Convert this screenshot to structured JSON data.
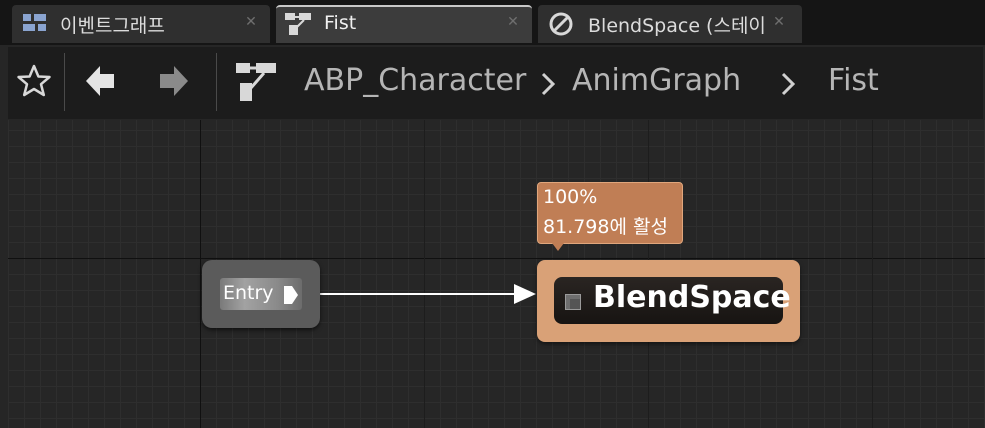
{
  "tabs": [
    {
      "label": "이벤트그래프",
      "icon": "event-graph-icon",
      "active": false
    },
    {
      "label": "Fist",
      "icon": "state-machine-icon",
      "active": true
    },
    {
      "label": "BlendSpace (스테이",
      "icon": "blendspace-icon",
      "active": false
    }
  ],
  "breadcrumb": {
    "items": [
      "ABP_Character",
      "AnimGraph",
      "Fist"
    ],
    "icon": "state-machine-icon"
  },
  "toolbar": {
    "favorite_icon": "star-icon",
    "back_icon": "back-arrow-icon",
    "forward_icon": "forward-arrow-icon"
  },
  "graph": {
    "entry_node": {
      "label": "Entry"
    },
    "state_node": {
      "label": "BlendSpace"
    },
    "tooltip": {
      "weight": "100%",
      "active_time": "81.798에 활성"
    }
  },
  "colors": {
    "state_node": "#d9a177",
    "tooltip": "#c07e55",
    "canvas": "#262626"
  }
}
